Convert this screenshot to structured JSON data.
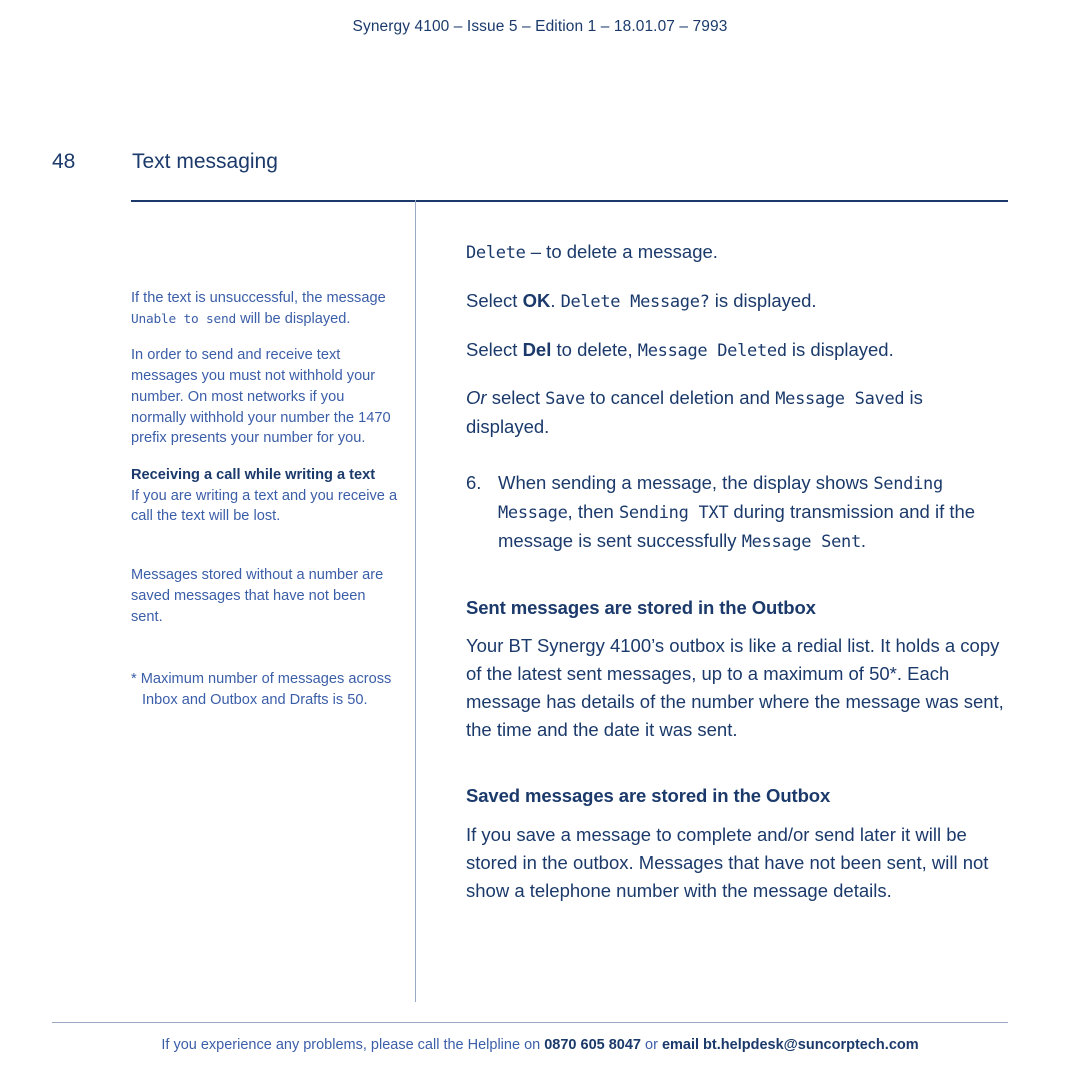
{
  "header": {
    "text": "Synergy 4100 – Issue 5 – Edition 1 – 18.01.07 – 7993"
  },
  "title": {
    "page_number": "48",
    "section": "Text messaging"
  },
  "sidebar": {
    "notes": [
      {
        "id": "note-unable-to-send",
        "parts": [
          {
            "t": "If the text is unsuccessful, the message ",
            "s": "normal"
          },
          {
            "t": "Unable to send",
            "s": "lcd"
          },
          {
            "t": " will be displayed.",
            "s": "normal"
          }
        ]
      },
      {
        "id": "note-withhold-number",
        "parts": [
          {
            "t": "In order to send and receive text messages you must not withhold your number. On most networks if you normally withhold your number the 1470 prefix presents your number for you.",
            "s": "normal"
          }
        ]
      }
    ],
    "heading_note": {
      "id": "note-receiving-call",
      "heading": "Receiving a call while writing a text",
      "body": "If you are writing a text and you receive a call the text will be lost."
    },
    "note_saved": {
      "id": "note-stored-without-number",
      "body": "Messages stored without a number are saved messages that have not been sent."
    },
    "footnote": {
      "id": "footnote-maximum",
      "marker": "*",
      "body": "Maximum number of messages across Inbox and Outbox and Drafts is 50."
    }
  },
  "main": {
    "delete_line": [
      {
        "t": "Delete",
        "s": "lcd"
      },
      {
        "t": " – to delete a message.",
        "s": "normal"
      }
    ],
    "select_ok_line": [
      {
        "t": "Select ",
        "s": "normal"
      },
      {
        "t": "OK",
        "s": "bold"
      },
      {
        "t": ". ",
        "s": "normal"
      },
      {
        "t": "Delete Message?",
        "s": "lcd"
      },
      {
        "t": " is displayed.",
        "s": "normal"
      }
    ],
    "select_del_line": [
      {
        "t": "Select ",
        "s": "normal"
      },
      {
        "t": "Del",
        "s": "bold"
      },
      {
        "t": " to delete, ",
        "s": "normal"
      },
      {
        "t": "Message Deleted",
        "s": "lcd"
      },
      {
        "t": " is displayed.",
        "s": "normal"
      }
    ],
    "or_save_line": [
      {
        "t": "Or",
        "s": "italic"
      },
      {
        "t": " select ",
        "s": "normal"
      },
      {
        "t": "Save",
        "s": "lcd"
      },
      {
        "t": " to cancel deletion and ",
        "s": "normal"
      },
      {
        "t": "Message Saved",
        "s": "lcd"
      },
      {
        "t": " is displayed.",
        "s": "normal"
      }
    ],
    "step6": {
      "number": "6.",
      "parts": [
        {
          "t": "When sending a message, the display shows ",
          "s": "normal"
        },
        {
          "t": "Sending Message",
          "s": "lcd"
        },
        {
          "t": ", then ",
          "s": "normal"
        },
        {
          "t": "Sending TXT",
          "s": "lcd"
        },
        {
          "t": " during transmission and if the message is sent successfully ",
          "s": "normal"
        },
        {
          "t": "Message Sent",
          "s": "lcd"
        },
        {
          "t": ".",
          "s": "normal"
        }
      ]
    },
    "sent_section": {
      "heading": "Sent messages are stored in the Outbox",
      "body": "Your BT Synergy 4100’s outbox is like a redial list. It holds a copy of the latest sent messages, up to a maximum of 50*. Each message has details of the number where the message was sent, the time and the date it was sent."
    },
    "saved_section": {
      "heading": "Saved messages are stored in the Outbox",
      "body": "If you save a message to complete and/or send later it will be stored in the outbox. Messages that have not been sent, will not show a telephone number with the message details."
    }
  },
  "footer": {
    "intro": "If you experience any problems, please call the Helpline on ",
    "phone": "0870 605 8047",
    "middle": " or ",
    "email_label": "email bt.helpdesk@suncorptech.com"
  },
  "colors": {
    "ink": "#1b3a6b",
    "accent": "#3b5ea8",
    "rule": "#9aa8c4"
  }
}
